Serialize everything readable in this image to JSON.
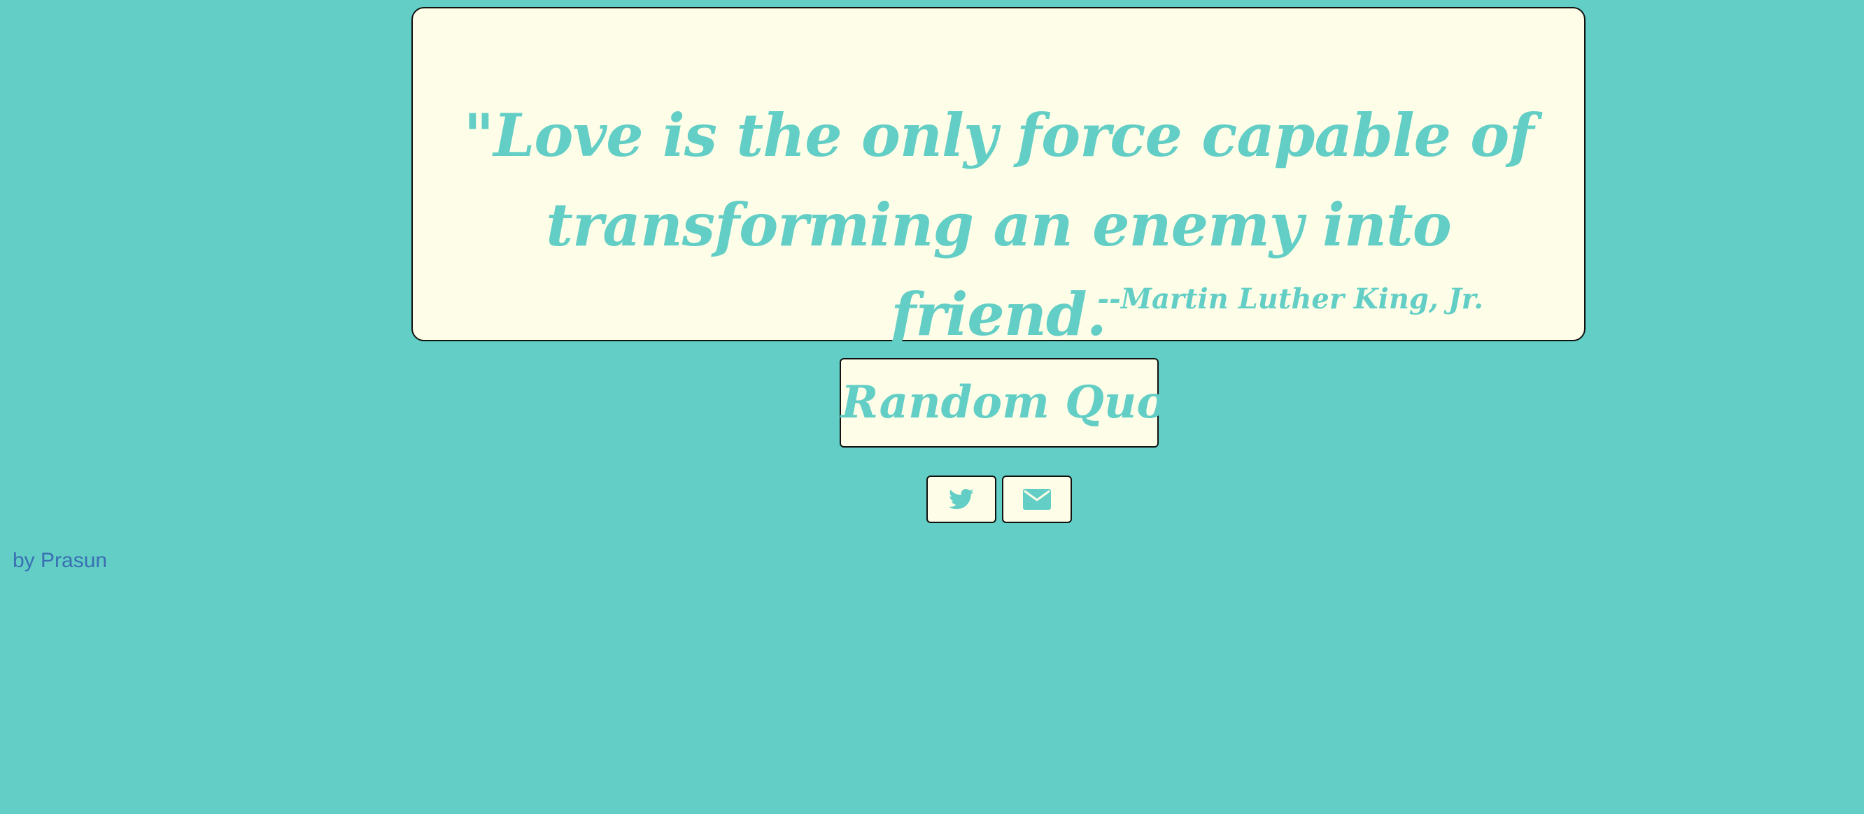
{
  "quote": {
    "text": "\"Love is the only force capable of transforming an enemy into friend.",
    "author": "--Martin Luther King, Jr."
  },
  "buttons": {
    "random_quote_label": "Random Quote",
    "twitter_icon": "twitter-icon",
    "email_icon": "envelope-icon"
  },
  "footer": {
    "credit": "by Prasun"
  },
  "colors": {
    "background": "#62cec5",
    "card": "#fefde7",
    "accent": "#62cec5",
    "credit_link": "#3a6fb3",
    "border": "#111111"
  }
}
